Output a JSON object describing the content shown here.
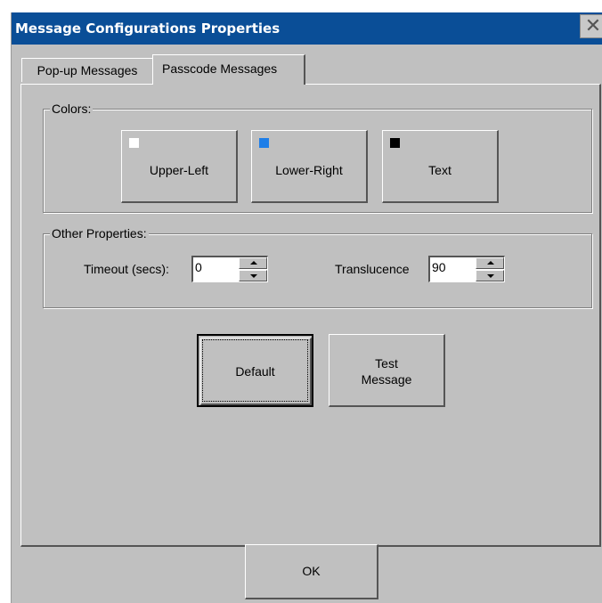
{
  "window": {
    "title": "Message Configurations Properties",
    "close_glyph": "✕"
  },
  "tabs": [
    {
      "label": "Pop-up Messages",
      "selected": false
    },
    {
      "label": "Passcode Messages",
      "selected": true
    }
  ],
  "colors_group": {
    "legend": "Colors:",
    "buttons": [
      {
        "label": "Upper-Left",
        "swatch": "#ffffff"
      },
      {
        "label": "Lower-Right",
        "swatch": "#1e7ee8"
      },
      {
        "label": "Text",
        "swatch": "#000000"
      }
    ]
  },
  "other_group": {
    "legend": "Other Properties:",
    "timeout_label": "Timeout (secs):",
    "timeout_value": "0",
    "translucence_label": "Translucence",
    "translucence_value": "90"
  },
  "actions": {
    "default_label": "Default",
    "test_line1": "Test",
    "test_line2": "Message",
    "ok_label": "OK"
  },
  "theme": {
    "titlebar": "#0a4e97",
    "face": "#c0c0c0"
  }
}
